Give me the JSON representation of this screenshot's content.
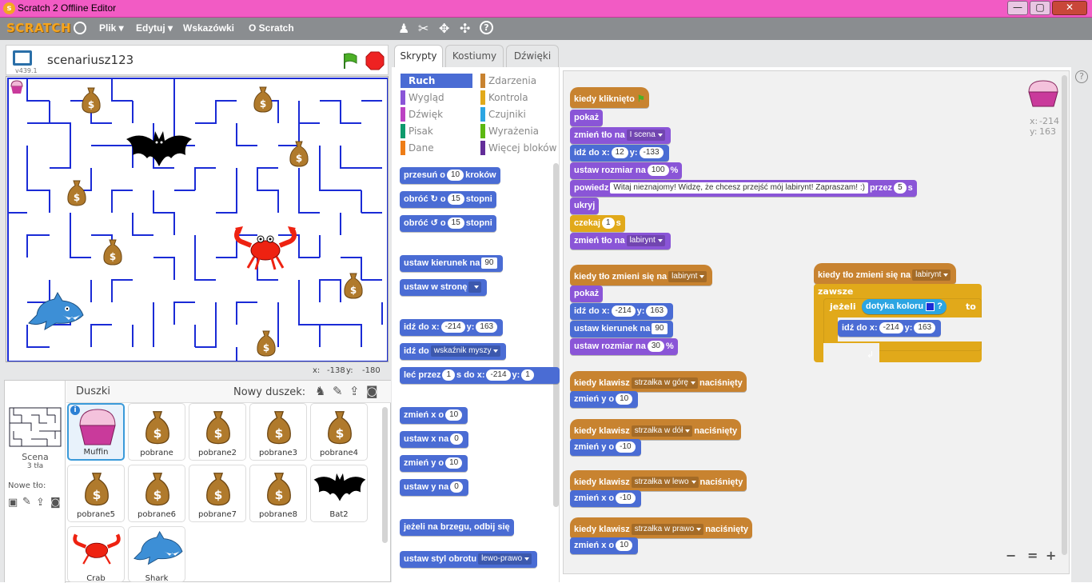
{
  "window": {
    "title": "Scratch 2 Offline Editor",
    "minimize": "—",
    "maximize": "▢",
    "close": "✕"
  },
  "menu": {
    "logo": "SCRATCH",
    "items": [
      "Plik ▾",
      "Edytuj ▾",
      "Wskazówki",
      "O Scratch"
    ]
  },
  "stage": {
    "project_name": "scenariusz123",
    "version": "v439.1",
    "mouse_x_label": "x:",
    "mouse_x": "-138",
    "mouse_y_label": "y:",
    "mouse_y": "-180"
  },
  "sprites_panel": {
    "title": "Duszki",
    "new_sprite_label": "Nowy duszek:",
    "scene_label": "Scena",
    "scene_backdrops": "3 tła",
    "new_backdrop_label": "Nowe tło:",
    "sprites": [
      "Muffin",
      "pobrane",
      "pobrane2",
      "pobrane3",
      "pobrane4",
      "pobrane5",
      "pobrane6",
      "pobrane7",
      "pobrane8",
      "Bat2",
      "Crab",
      "Shark"
    ]
  },
  "tabs": [
    "Skrypty",
    "Kostiumy",
    "Dźwięki"
  ],
  "categories": {
    "left": [
      {
        "label": "Ruch",
        "color": "#4a6cd4"
      },
      {
        "label": "Wygląd",
        "color": "#8a55d7"
      },
      {
        "label": "Dźwięk",
        "color": "#bb42c3"
      },
      {
        "label": "Pisak",
        "color": "#0e9a6c"
      },
      {
        "label": "Dane",
        "color": "#ee7d16"
      }
    ],
    "right": [
      {
        "label": "Zdarzenia",
        "color": "#c88330"
      },
      {
        "label": "Kontrola",
        "color": "#e1a91a"
      },
      {
        "label": "Czujniki",
        "color": "#2ca5e2"
      },
      {
        "label": "Wyrażenia",
        "color": "#5cb712"
      },
      {
        "label": "Więcej bloków",
        "color": "#632d99"
      }
    ]
  },
  "palette": {
    "move_steps": [
      "przesuń o",
      "10",
      "kroków"
    ],
    "turn_right": [
      "obróć",
      "↻",
      "o",
      "15",
      "stopni"
    ],
    "turn_left": [
      "obróć",
      "↺",
      "o",
      "15",
      "stopni"
    ],
    "point_dir": [
      "ustaw kierunek na",
      "90"
    ],
    "point_towards": [
      "ustaw w stronę",
      ""
    ],
    "goto_xy": [
      "idź do x:",
      "-214",
      "y:",
      "163"
    ],
    "goto": [
      "idź do",
      "wskaźnik myszy"
    ],
    "glide": [
      "leć przez",
      "1",
      "s do x:",
      "-214",
      "y:",
      "1"
    ],
    "change_x": [
      "zmień x o",
      "10"
    ],
    "set_x": [
      "ustaw x na",
      "0"
    ],
    "change_y": [
      "zmień y o",
      "10"
    ],
    "set_y": [
      "ustaw y na",
      "0"
    ],
    "bounce": "jeżeli na brzegu, odbij się",
    "rotation_style": [
      "ustaw styl obrotu",
      "lewo-prawo"
    ]
  },
  "scripts": {
    "s1": {
      "hat": "kiedy kliknięto",
      "show": "pokaż",
      "backdrop": [
        "zmień tło na",
        "I scena"
      ],
      "goto": [
        "idź do x:",
        "12",
        "y:",
        "-133"
      ],
      "size": [
        "ustaw rozmiar na",
        "100",
        "%"
      ],
      "say": [
        "powiedz",
        "Witaj nieznajomy! Widzę, że chcesz przejść mój labirynt! Zapraszam! :)",
        "przez",
        "5",
        "s"
      ],
      "hide": "ukryj",
      "wait": [
        "czekaj",
        "1",
        "s"
      ],
      "backdrop2": [
        "zmień tło na",
        "labirynt"
      ]
    },
    "s2": {
      "hat": [
        "kiedy tło zmieni się na",
        "labirynt"
      ],
      "show": "pokaż",
      "goto": [
        "idź do x:",
        "-214",
        "y:",
        "163"
      ],
      "dir": [
        "ustaw kierunek na",
        "90"
      ],
      "size": [
        "ustaw rozmiar na",
        "30",
        "%"
      ]
    },
    "s3": {
      "hat": [
        "kiedy tło zmieni się na",
        "labirynt"
      ],
      "forever": "zawsze",
      "if": [
        "jeżeli",
        "dotyka koloru",
        "?",
        "to"
      ],
      "goto": [
        "idź do x:",
        "-214",
        "y:",
        "163"
      ],
      "touch_color": "#1a2bd6"
    },
    "key_up": {
      "hat": [
        "kiedy klawisz",
        "strzałka w górę",
        "naciśnięty"
      ],
      "body": [
        "zmień y o",
        "10"
      ]
    },
    "key_down": {
      "hat": [
        "kiedy klawisz",
        "strzałka w dół",
        "naciśnięty"
      ],
      "body": [
        "zmień y o",
        "-10"
      ]
    },
    "key_left": {
      "hat": [
        "kiedy klawisz",
        "strzałka w lewo",
        "naciśnięty"
      ],
      "body": [
        "zmień x o",
        "-10"
      ]
    },
    "key_right": {
      "hat": [
        "kiedy klawisz",
        "strzałka w prawo",
        "naciśnięty"
      ],
      "body": [
        "zmień x o",
        "10"
      ]
    }
  },
  "sprite_info": {
    "x_label": "x:",
    "x": "-214",
    "y_label": "y:",
    "y": "163"
  },
  "zoom": {
    "out": "−",
    "reset": "=",
    "in": "+"
  },
  "help": "?"
}
